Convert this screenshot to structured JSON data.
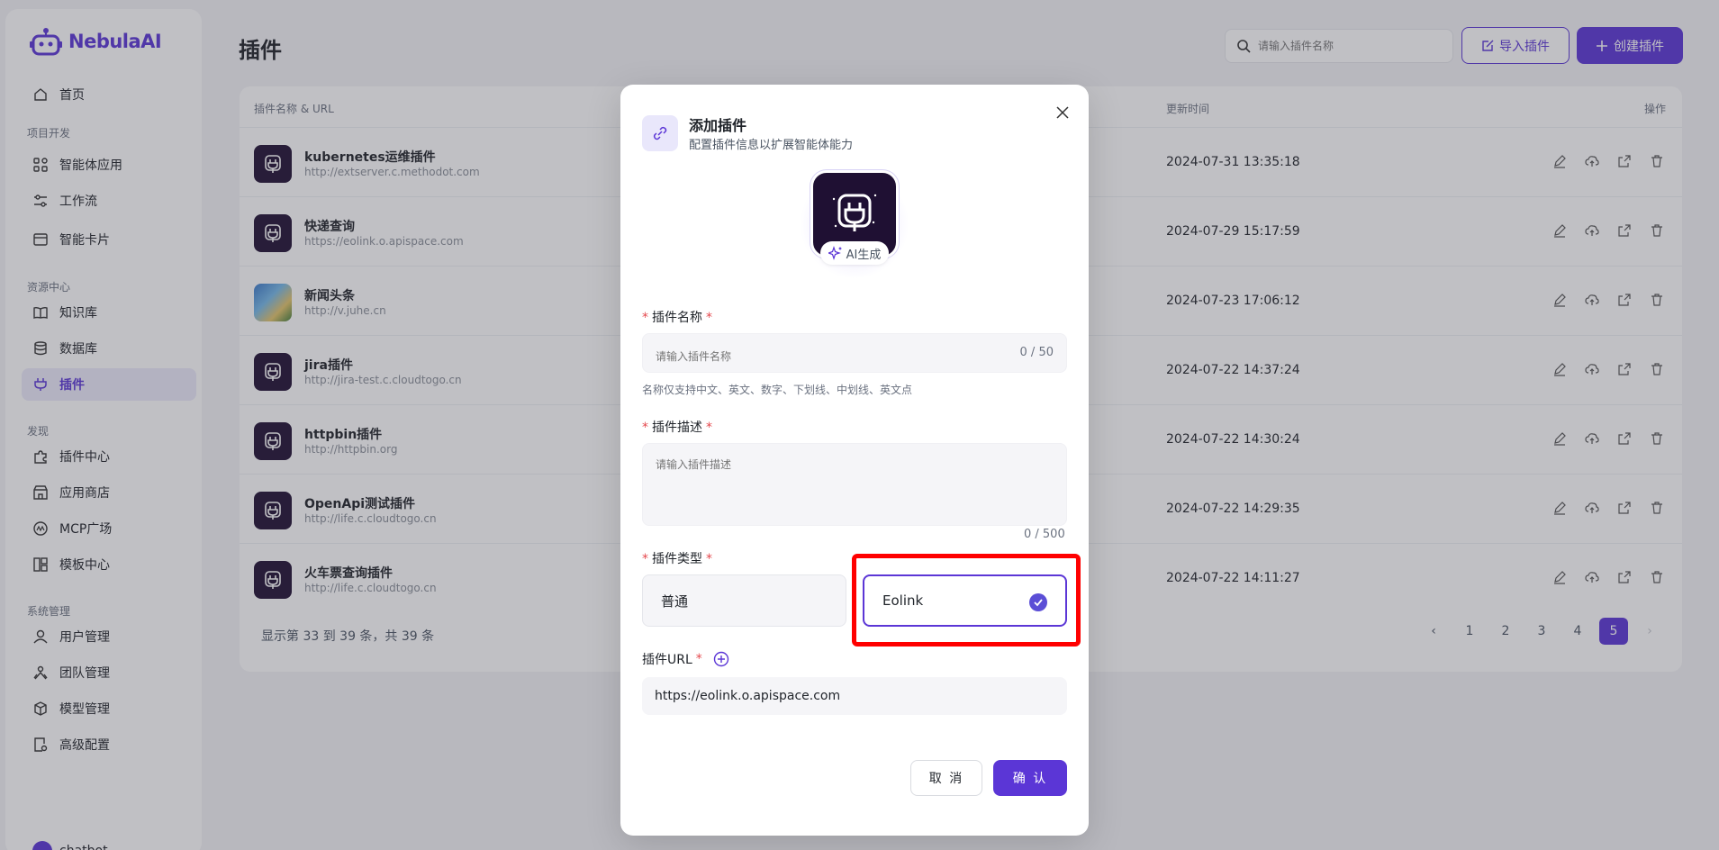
{
  "app": {
    "logo_text": "NebulaAI",
    "accent": "#5b36d6"
  },
  "sidebar": {
    "home": "首页",
    "sections": [
      "项目开发",
      "资源中心",
      "发现",
      "系统管理"
    ],
    "items": [
      "智能体应用",
      "工作流",
      "智能卡片",
      "知识库",
      "数据库",
      "插件",
      "插件中心",
      "应用商店",
      "MCP广场",
      "模板中心",
      "用户管理",
      "团队管理",
      "模型管理",
      "高级配置"
    ],
    "user": "chatbot"
  },
  "header": {
    "title": "插件",
    "search_placeholder": "请输入插件名称",
    "import_label": "导入插件",
    "create_label": "创建插件"
  },
  "table": {
    "col_name": "插件名称 & URL",
    "col_time": "更新时间",
    "col_actions": "操作",
    "rows": [
      {
        "name": "kubernetes运维插件",
        "url": "http://extserver.c.methodot.com",
        "time": "2024-07-31 13:35:18"
      },
      {
        "name": "快递查询",
        "url": "https://eolink.o.apispace.com",
        "time": "2024-07-29 15:17:59"
      },
      {
        "name": "新闻头条",
        "url": "http://v.juhe.cn",
        "time": "2024-07-23 17:06:12"
      },
      {
        "name": "jira插件",
        "url": "http://jira-test.c.cloudtogo.cn",
        "time": "2024-07-22 14:37:24"
      },
      {
        "name": "httpbin插件",
        "url": "http://httpbin.org",
        "time": "2024-07-22 14:30:24"
      },
      {
        "name": "OpenApi测试插件",
        "url": "http://life.c.cloudtogo.cn",
        "time": "2024-07-22 14:29:35"
      },
      {
        "name": "火车票查询插件",
        "url": "http://life.c.cloudtogo.cn",
        "time": "2024-07-22 14:11:27"
      }
    ],
    "footer": "显示第 33 到 39 条，共 39 条",
    "pages": [
      "1",
      "2",
      "3",
      "4",
      "5"
    ],
    "current_page": "5"
  },
  "modal": {
    "title": "添加插件",
    "subtitle": "配置插件信息以扩展智能体能力",
    "ai_badge": "AI生成",
    "name_label": "插件名称",
    "name_placeholder": "请输入插件名称",
    "name_counter": "0 / 50",
    "name_hint": "名称仅支持中文、英文、数字、下划线、中划线、英文点",
    "desc_label": "插件描述",
    "desc_placeholder": "请输入插件描述",
    "desc_counter": "0 / 500",
    "type_label": "插件类型",
    "type_normal": "普通",
    "type_eolink": "Eolink",
    "url_label": "插件URL",
    "url_value": "https://eolink.o.apispace.com",
    "cancel_label": "取 消",
    "ok_label": "确 认"
  }
}
